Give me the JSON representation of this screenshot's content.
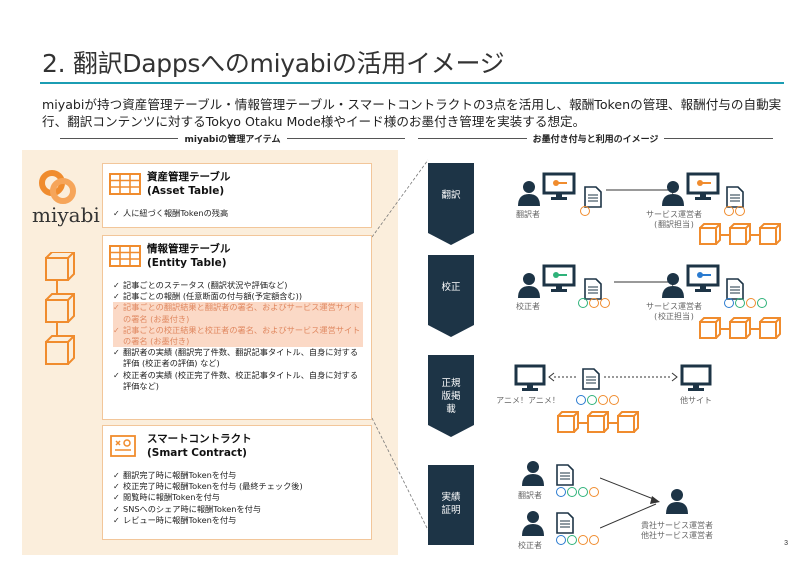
{
  "slide": {
    "title": "2. 翻訳Dappsへのmiyabiの活用イメージ",
    "intro": "miyabiが持つ資産管理テーブル・情報管理テーブル・スマートコントラクトの3点を活用し、報酬Tokenの管理、報酬付与の自動実行、翻訳コンテンツに対するTokyo Otaku Mode様やイード様のお墨付き管理を実装する想定。",
    "page_number": "3"
  },
  "left_section": {
    "heading": "miyabiの管理アイテム",
    "logo_text": "miyabi",
    "cards": [
      {
        "title_ja": "資産管理テーブル",
        "title_en": "(Asset Table)",
        "items": [
          "人に紐づく報酬Tokenの残高"
        ]
      },
      {
        "title_ja": "情報管理テーブル",
        "title_en": "(Entity Table)",
        "items": [
          "記事ごとのステータス (翻訳状況や評価など)",
          "記事ごとの報酬 (任意断面の付与額(予定額含む))",
          "記事ごとの翻訳結果と翻訳者の署名、およびサービス運営サイトの署名 (お墨付き)",
          "記事ごとの校正結果と校正者の署名、およびサービス運営サイトの署名 (お墨付き)",
          "翻訳者の実績 (翻訳完了件数、翻訳記事タイトル、自身に対する評価 (校正者の評価) など)",
          "校正者の実績 (校正完了件数、校正記事タイトル、自身に対する評価など)"
        ]
      },
      {
        "title_ja": "スマートコントラクト",
        "title_en": "(Smart Contract)",
        "items": [
          "翻訳完了時に報酬Tokenを付与",
          "校正完了時に報酬Tokenを付与 (最終チェック後)",
          "閲覧時に報酬Tokenを付与",
          "SNSへのシェア時に報酬Tokenを付与",
          "レビュー時に報酬Tokenを付与"
        ]
      }
    ]
  },
  "right_section": {
    "heading": "お墨付き付与と利用のイメージ",
    "stages": [
      {
        "label": "翻訳"
      },
      {
        "label": "校正"
      },
      {
        "label": "正規版掲載"
      },
      {
        "label": "実績証明"
      }
    ],
    "captions": {
      "translator": "翻訳者",
      "operator_translation": "サービス運営者\n(翻訳担当)",
      "proofreader": "校正者",
      "operator_proofreading": "サービス運営者\n(校正担当)",
      "anime_site": "アニメ！アニメ！",
      "other_site": "他サイト",
      "translator2": "翻訳者",
      "proofreader2": "校正者",
      "operators": "貴社サービス運営者\n他社サービス運営者"
    }
  },
  "colors": {
    "accent_teal": "#1b9db3",
    "orange": "#f08c2e",
    "green": "#2fb27a",
    "blue": "#2a7bd0",
    "navy": "#1d3446",
    "panel": "#fbeedc"
  }
}
